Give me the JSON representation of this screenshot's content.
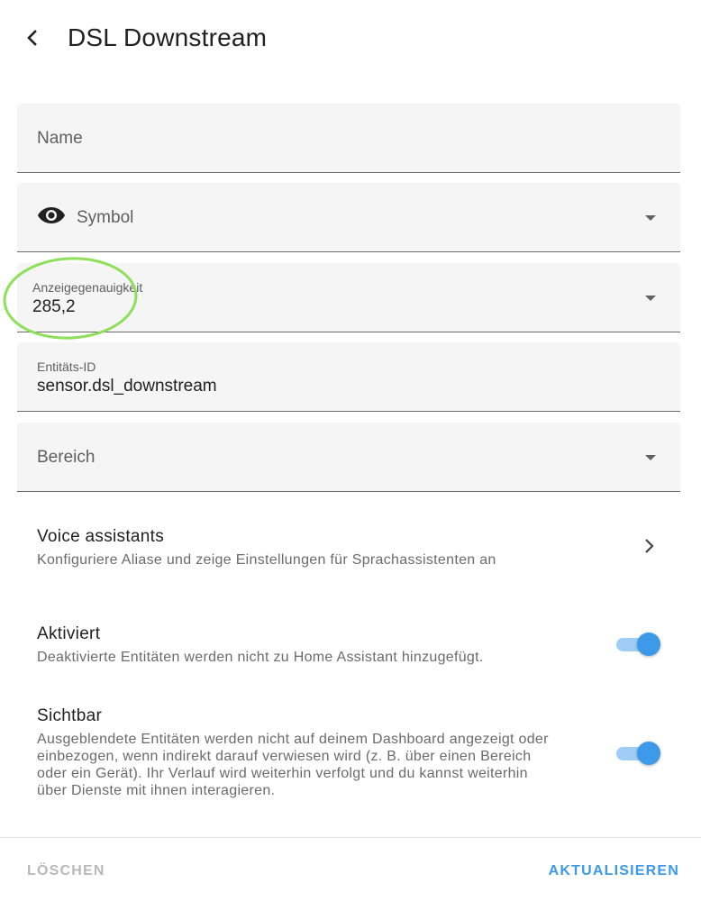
{
  "header": {
    "title": "DSL Downstream",
    "back_icon": "chevron-left-icon"
  },
  "form": {
    "name": {
      "label": "Name",
      "value": ""
    },
    "symbol": {
      "label": "Symbol",
      "icon": "eye-icon"
    },
    "precision": {
      "label": "Anzeigegenauigkeit",
      "value": "285,2"
    },
    "entity_id": {
      "label": "Entitäts-ID",
      "value": "sensor.dsl_downstream"
    },
    "area": {
      "label": "Bereich"
    }
  },
  "voice": {
    "title": "Voice assistants",
    "subtitle": "Konfiguriere Aliase und zeige Einstellungen für Sprachassistenten an"
  },
  "enabled": {
    "title": "Aktiviert",
    "subtitle": "Deaktivierte Entitäten werden nicht zu Home Assistant hinzugefügt.",
    "on": true
  },
  "visible": {
    "title": "Sichtbar",
    "subtitle_lines": [
      "Ausgeblendete Entitäten werden nicht auf deinem Dashboard angezeigt oder",
      "einbezogen, wenn indirekt darauf verwiesen wird (z. B. über einen Bereich",
      "oder ein Gerät). Ihr Verlauf wird weiterhin verfolgt und du kannst weiterhin",
      "über Dienste mit ihnen interagieren."
    ],
    "on": true
  },
  "footer": {
    "delete_label": "LÖSCHEN",
    "update_label": "AKTUALISIEREN"
  },
  "colors": {
    "accent": "#3d9ae8",
    "annotation": "#8ee05a"
  }
}
